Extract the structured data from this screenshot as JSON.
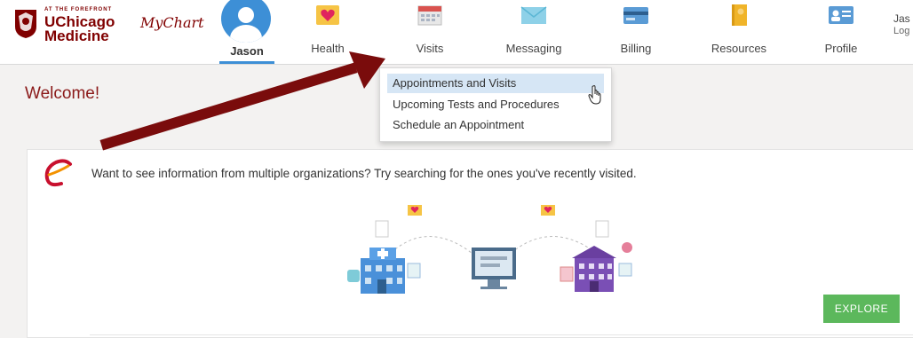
{
  "brand": {
    "tagline": "AT THE FOREFRONT",
    "name_line1": "UChicago",
    "name_line2": "Medicine",
    "app_name": "MyChart",
    "color": "#800000"
  },
  "user": {
    "name": "Jason",
    "account_short": "Jas",
    "logout_short": "Log"
  },
  "nav": [
    {
      "label": "Health",
      "icon": "heart-icon"
    },
    {
      "label": "Visits",
      "icon": "calendar-icon"
    },
    {
      "label": "Messaging",
      "icon": "envelope-icon"
    },
    {
      "label": "Billing",
      "icon": "credit-card-icon"
    },
    {
      "label": "Resources",
      "icon": "book-icon"
    },
    {
      "label": "Profile",
      "icon": "id-card-icon"
    }
  ],
  "visits_menu": {
    "items": [
      {
        "label": "Appointments and Visits",
        "highlighted": true
      },
      {
        "label": "Upcoming Tests and Procedures"
      },
      {
        "label": "Schedule an Appointment"
      }
    ]
  },
  "main": {
    "welcome": "Welcome!",
    "card": {
      "text": "Want to see information from multiple organizations? Try searching for the ones you've recently visited.",
      "button": "EXPLORE"
    }
  },
  "colors": {
    "accent": "#3d8fd6",
    "welcome": "#8b1a1a",
    "explore": "#5cb85c",
    "arrow": "#7a0c0c",
    "highlight": "#d6e6f5"
  }
}
